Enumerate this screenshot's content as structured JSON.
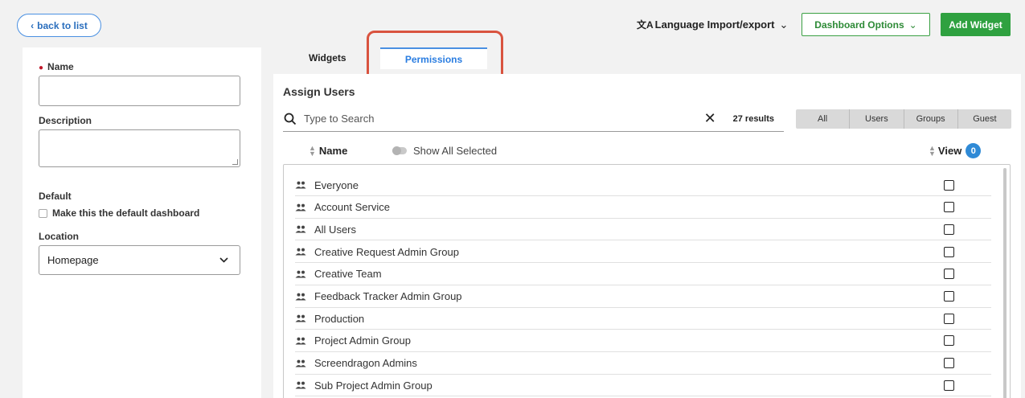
{
  "header": {
    "back_label": "back to list",
    "language_label": "Language Import/export",
    "dashboard_options_label": "Dashboard Options",
    "add_widget_label": "Add Widget"
  },
  "form": {
    "name_label": "Name",
    "description_label": "Description",
    "default_label": "Default",
    "default_checkbox_label": "Make this the default dashboard",
    "location_label": "Location",
    "location_value": "Homepage"
  },
  "tabs": {
    "widgets": "Widgets",
    "permissions": "Permissions"
  },
  "assign": {
    "title": "Assign Users",
    "search_placeholder": "Type to Search",
    "results": "27 results",
    "filters": [
      "All",
      "Users",
      "Groups",
      "Guest"
    ],
    "name_column": "Name",
    "show_all_selected": "Show All Selected",
    "view_column": "View",
    "view_count": "0"
  },
  "groups": [
    "Everyone",
    "Account Service",
    "All Users",
    "Creative Request Admin Group",
    "Creative Team",
    "Feedback Tracker Admin Group",
    "Production",
    "Project Admin Group",
    "Screendragon Admins",
    "Sub Project Admin Group"
  ],
  "colors": {
    "accent_blue": "#2a7de1",
    "green": "#2fa140",
    "highlight_red": "#d9533f",
    "required_red": "#c0182a"
  }
}
